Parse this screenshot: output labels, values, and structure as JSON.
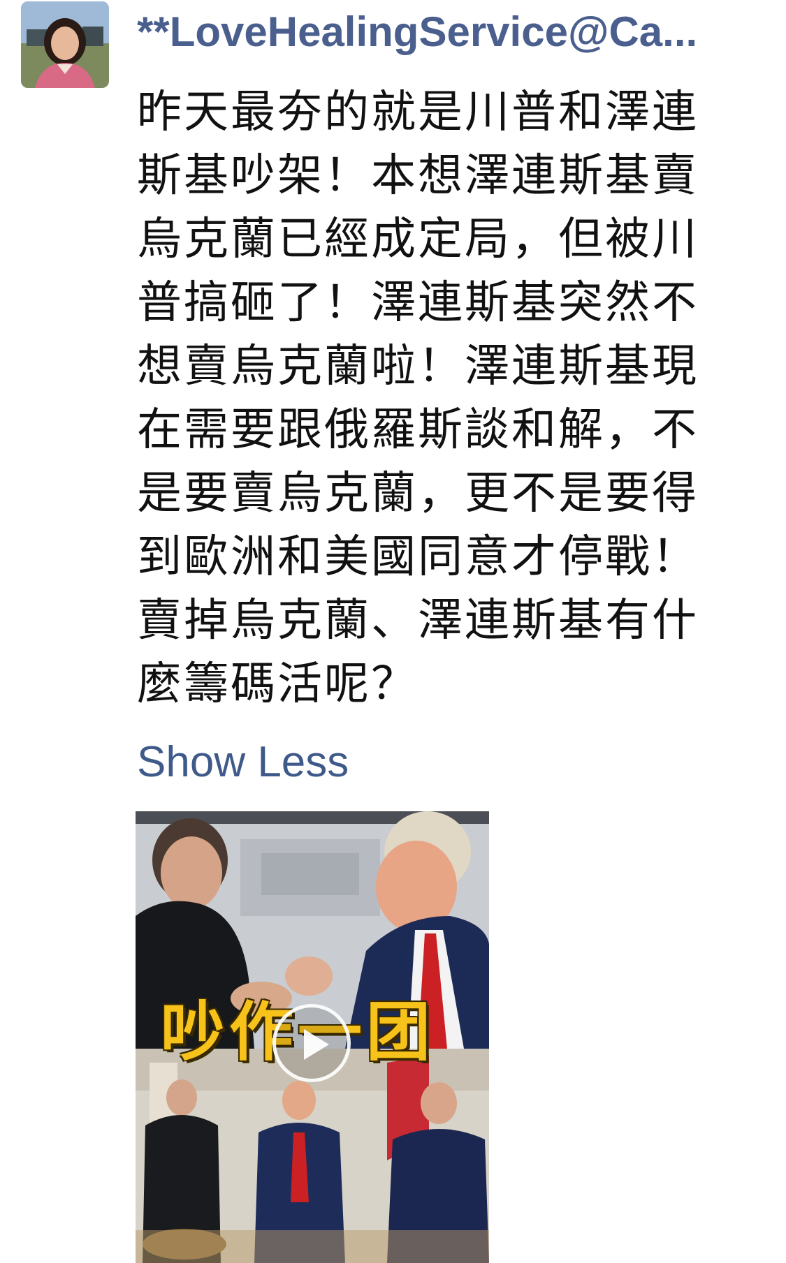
{
  "author": {
    "name": "**LoveHealingService@Ca..."
  },
  "post": {
    "lines": [
      "昨天最夯的就是川普和澤連",
      "斯基吵架！本想澤連斯基賣",
      "烏克蘭已經成定局，但被川",
      "普搞砸了！澤連斯基突然不",
      "想賣烏克蘭啦！澤連斯基現",
      "在需要跟俄羅斯談和解，不",
      "是要賣烏克蘭，更不是要得",
      "到歐洲和美國同意才停戰！",
      "賣掉烏克蘭、澤連斯基有什",
      "麼籌碼活呢？"
    ],
    "show_less_label": "Show Less"
  },
  "video": {
    "caption": "吵作一团",
    "play_icon": "play-icon",
    "accent_color": "#f7c21a"
  },
  "colors": {
    "author": "#4a5f8e",
    "link": "#3f5a8a",
    "text": "#111111"
  }
}
